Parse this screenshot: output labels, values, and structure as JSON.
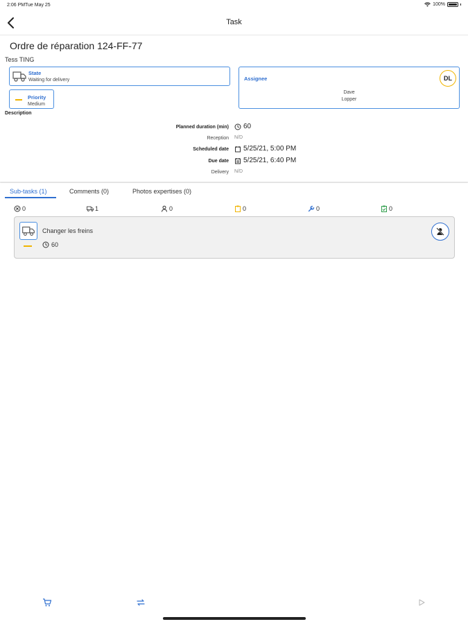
{
  "status_bar": {
    "time": "2:06 PM",
    "date": "Tue May 25",
    "battery": "100%"
  },
  "navbar": {
    "title": "Task"
  },
  "task": {
    "title": "Ordre de réparation 124-FF-77",
    "customer": "Tess TING",
    "state": {
      "label": "State",
      "value": "Waiting for delivery"
    },
    "priority": {
      "label": "Priority",
      "value": "Medium"
    },
    "assignee": {
      "label": "Assignee",
      "initials": "DL",
      "first_name": "Dave",
      "last_name": "Lopper"
    },
    "description_label": "Description",
    "details": [
      {
        "label": "Planned duration (min)",
        "value": "60",
        "icon": "clock-icon"
      },
      {
        "label": "Reception",
        "value": "N/D",
        "icon": ""
      },
      {
        "label": "Scheduled date",
        "value": "5/25/21, 5:00 PM",
        "icon": "calendar-icon"
      },
      {
        "label": "Due date",
        "value": "5/25/21, 6:40 PM",
        "icon": "calendar-due-icon"
      },
      {
        "label": "Delivery",
        "value": "N/D",
        "icon": ""
      }
    ]
  },
  "tabs": [
    {
      "label": "Sub-tasks (1)",
      "active": true
    },
    {
      "label": "Comments (0)",
      "active": false
    },
    {
      "label": "Photos expertises (0)",
      "active": false
    }
  ],
  "counters": [
    {
      "icon": "cancel-icon",
      "value": "0",
      "color": "#333333"
    },
    {
      "icon": "truck-icon",
      "value": "1",
      "color": "#333333"
    },
    {
      "icon": "person-icon",
      "value": "0",
      "color": "#333333"
    },
    {
      "icon": "clipboard-icon",
      "value": "0",
      "color": "#f0b400"
    },
    {
      "icon": "wrench-icon",
      "value": "0",
      "color": "#2f6fd0"
    },
    {
      "icon": "clipboard-check-icon",
      "value": "0",
      "color": "#2e9d4a"
    }
  ],
  "subtasks": [
    {
      "title": "Changer les freins",
      "duration": "60",
      "state_icon": "truck-icon",
      "action_icon": "unassign-user-icon"
    }
  ],
  "toolbar": {
    "left_icon": "cart-icon",
    "middle_icon": "swap-icon",
    "right_icon": "play-icon"
  },
  "colors": {
    "accent": "#2f6fd0",
    "priority_medium": "#f0b400",
    "border": "#4a8fe0"
  }
}
